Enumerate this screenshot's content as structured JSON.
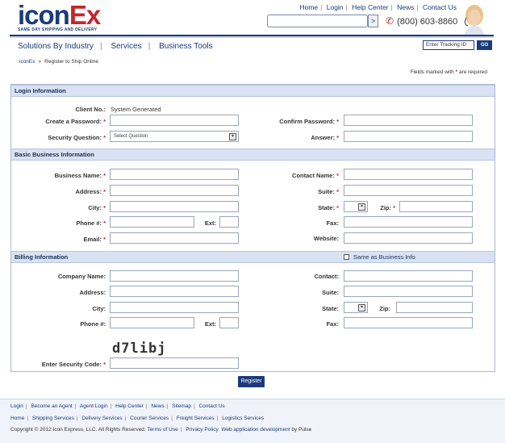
{
  "brand": {
    "logo_part1": "icon",
    "logo_part2": "Ex",
    "tagline": "SAME DAY SHIPPING AND DELIVERY"
  },
  "topnav": [
    "Home",
    "Login",
    "Help Center",
    "News",
    "Contact Us"
  ],
  "phone": "(800) 603-8860",
  "search": {
    "button": ">"
  },
  "mainnav": [
    "Solutions By Industry",
    "Services",
    "Business Tools"
  ],
  "tracking": {
    "placeholder": "Enter Tracking ID",
    "button": "GO"
  },
  "breadcrumb": [
    "iconEx",
    "Register to Ship Online"
  ],
  "required_note": {
    "prefix": "Fields marked with",
    "marker": "*",
    "suffix": "are required"
  },
  "sections": {
    "login": {
      "title": "Login Information",
      "client_no_label": "Client No.:",
      "client_no_value": "System Generated",
      "create_password": "Create a Password:",
      "confirm_password": "Confirm Password:",
      "security_question": "Security Question:",
      "security_select": "Select Question",
      "answer": "Answer:"
    },
    "business": {
      "title": "Basic Business Information",
      "business_name": "Business Name:",
      "contact_name": "Contact Name:",
      "address": "Address:",
      "suite": "Suite:",
      "city": "City:",
      "state": "State:",
      "zip": "Zip:",
      "phone": "Phone #:",
      "ext": "Ext:",
      "fax": "Fax:",
      "email": "Email:",
      "website": "Website:"
    },
    "billing": {
      "title": "Billing Information",
      "same_as": "Same as Business Info",
      "company_name": "Company Name:",
      "contact": "Contact:",
      "address": "Address:",
      "suite": "Suite:",
      "city": "City:",
      "state": "State:",
      "zip": "Zip:",
      "phone": "Phone #:",
      "ext": "Ext:",
      "fax": "Fax:",
      "captcha_text": "d7libj",
      "security_code": "Enter Security Code:"
    }
  },
  "register_button": "Register",
  "footer": {
    "row1": [
      "Login",
      "Become an Agent",
      "Agent Login",
      "Help Center",
      "News",
      "Sitemap",
      "Contact Us"
    ],
    "row2": [
      "Home",
      "Shipping Services",
      "Delivery Services",
      "Courier Services",
      "Freight Services",
      "Logistics Services"
    ],
    "copyright": "Copyright © 2012 Icon Express, LLC. All Rights Reserved.",
    "terms": "Terms of Use",
    "privacy": "Privacy Policy",
    "webdev": "Web application development",
    "by": "by Pulse"
  },
  "colors": {
    "brand_blue": "#1a3b7a",
    "brand_red": "#c2272d",
    "section_bg": "#d9e2f2"
  }
}
